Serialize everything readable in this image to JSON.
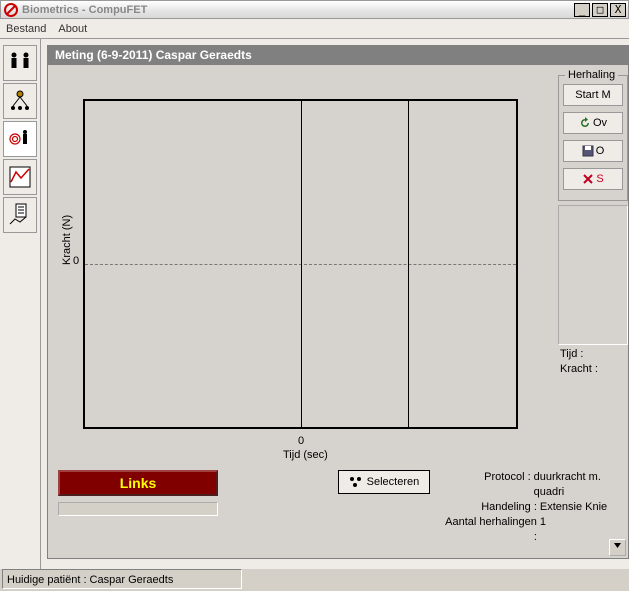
{
  "window": {
    "title": "Biometrics - CompuFET",
    "min": "_",
    "max": "□",
    "close": "X"
  },
  "menu": {
    "file": "Bestand",
    "about": "About"
  },
  "panel": {
    "title": "Meting  (6-9-2011) Caspar Geraedts"
  },
  "chart_data": {
    "type": "line",
    "title": "",
    "xlabel": "Tijd (sec)",
    "ylabel": "Kracht (N)",
    "xtick_center": "0",
    "ytick_center": "0",
    "series": [],
    "xlim": [
      null,
      null
    ],
    "ylim": [
      null,
      null
    ]
  },
  "right": {
    "legend": "Herhaling",
    "start": "Start M",
    "overnieuw": "Ov",
    "opslaan": "O",
    "stop": "S",
    "tijd_label": "Tijd   :",
    "kracht_label": "Kracht :"
  },
  "bottom": {
    "links": "Links",
    "selecteren": "Selecteren",
    "protocol_lbl": "Protocol :",
    "protocol_val": "duurkracht m. quadri",
    "handeling_lbl": "Handeling :",
    "handeling_val": "Extensie Knie",
    "aantal_lbl": "Aantal herhalingen :",
    "aantal_val": "1"
  },
  "status": {
    "text": "Huidige patiënt : Caspar Geraedts"
  }
}
